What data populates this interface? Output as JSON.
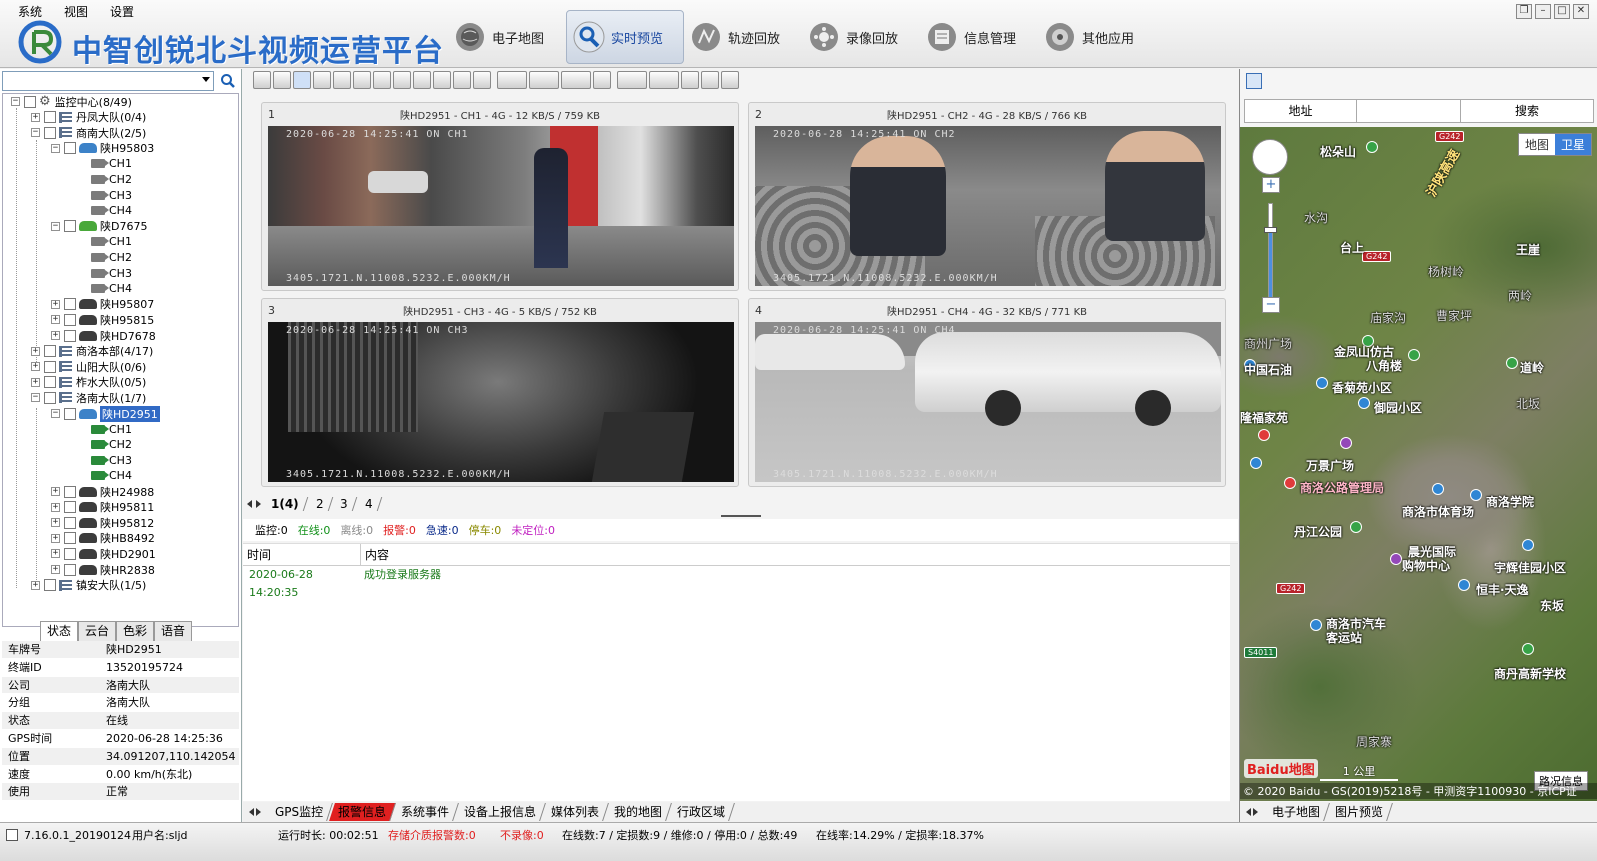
{
  "menu": [
    "系统",
    "视图",
    "设置"
  ],
  "app_title": "中智创锐北斗视频运营平台",
  "nav": [
    {
      "label": "电子地图",
      "icon": "globe-icon",
      "active": false
    },
    {
      "label": "实时预览",
      "icon": "search-icon",
      "active": true
    },
    {
      "label": "轨迹回放",
      "icon": "route-icon",
      "active": false
    },
    {
      "label": "录像回放",
      "icon": "film-reel-icon",
      "active": false
    },
    {
      "label": "信息管理",
      "icon": "folder-icon",
      "active": false
    },
    {
      "label": "其他应用",
      "icon": "disc-icon",
      "active": false
    }
  ],
  "search": {
    "value": "",
    "placeholder": ""
  },
  "tree": {
    "root": "监控中心(8/49)",
    "groups": {
      "g1": "丹凤大队(0/4)",
      "g2": "商南大队(2/5)",
      "g3": "商洛本部(4/17)",
      "g4": "山阳大队(0/6)",
      "g5": "柞水大队(0/5)",
      "g6": "洛南大队(1/7)",
      "g7": "镇安大队(1/5)"
    },
    "vehicles": {
      "v1": "陕H95803",
      "v2": "陕D7675",
      "v3": "陕H95807",
      "v4": "陕H95815",
      "v5": "陕HD7678",
      "v6": "陕HD2951",
      "v7": "陕H24988",
      "v8": "陕H95811",
      "v9": "陕H95812",
      "v10": "陕HB8492",
      "v11": "陕HD2901",
      "v12": "陕HR2838"
    },
    "channels": [
      "CH1",
      "CH2",
      "CH3",
      "CH4"
    ]
  },
  "left_tabs": [
    "状态",
    "云台",
    "色彩",
    "语音"
  ],
  "props": [
    {
      "k": "车牌号",
      "v": "陕HD2951"
    },
    {
      "k": "终端ID",
      "v": "13520195724"
    },
    {
      "k": "公司",
      "v": "洛南大队"
    },
    {
      "k": "分组",
      "v": "洛南大队"
    },
    {
      "k": "状态",
      "v": "在线"
    },
    {
      "k": "GPS时间",
      "v": "2020-06-28 14:25:36"
    },
    {
      "k": "位置",
      "v": "34.091207,110.142054"
    },
    {
      "k": "速度",
      "v": "0.00 km/h(东北)"
    },
    {
      "k": "使用",
      "v": "正常"
    }
  ],
  "videos": [
    {
      "num": "1",
      "title": "陕HD2951 - CH1 - 4G - 12 KB/S / 759 KB",
      "osd_top": "2020-06-28 14:25:41  ON   CH1",
      "osd_bot": "3405.1721.N.11008.5232.E.000KM/H"
    },
    {
      "num": "2",
      "title": "陕HD2951 - CH2 - 4G - 28 KB/S / 766 KB",
      "osd_top": "2020-06-28 14:25:41  ON   CH2",
      "osd_bot": "3405.1721.N.11008.5232.E.000KM/H"
    },
    {
      "num": "3",
      "title": "陕HD2951 - CH3 - 4G - 5 KB/S / 752 KB",
      "osd_top": "2020-06-28 14:25:41  ON   CH3",
      "osd_bot": "3405.1721.N.11008.5232.E.000KM/H"
    },
    {
      "num": "4",
      "title": "陕HD2951 - CH4 - 4G - 32 KB/S / 771 KB",
      "osd_top": "2020-06-28 14:25:41  ON   CH4",
      "osd_bot": "3405.1721.N.11008.5232.E.000KM/H"
    }
  ],
  "pages": [
    "1(4)",
    "2",
    "3",
    "4"
  ],
  "counts": [
    {
      "label": "监控:0",
      "color": "#000000"
    },
    {
      "label": "在线:0",
      "color": "#12911a"
    },
    {
      "label": "离线:0",
      "color": "#8a8a8a"
    },
    {
      "label": "报警:0",
      "color": "#e02020"
    },
    {
      "label": "急速:0",
      "color": "#0a2a8a"
    },
    {
      "label": "停车:0",
      "color": "#8a8a00"
    },
    {
      "label": "未定位:0",
      "color": "#c020c0"
    }
  ],
  "log": {
    "headers": [
      "时间",
      "内容"
    ],
    "rows": [
      {
        "time": "2020-06-28 14:20:35",
        "msg": "成功登录服务器"
      }
    ]
  },
  "bottom_tabs": [
    "GPS监控",
    "报警信息",
    "系统事件",
    "设备上报信息",
    "媒体列表",
    "我的地图",
    "行政区域"
  ],
  "map": {
    "search_tabs": [
      "地址",
      "",
      "搜索"
    ],
    "type_buttons": [
      "地图",
      "卫星"
    ],
    "labels": [
      "松朵山",
      "台上",
      "王崖",
      "杨树岭",
      "庙家沟",
      "曹家坪",
      "金凤山仿古",
      "八角楼",
      "道岭",
      "中国石油",
      "香菊苑小区",
      "御园小区",
      "隆福家苑",
      "万景广场",
      "商洛公路管理局",
      "商洛学院",
      "商洛市体育场",
      "丹江公园",
      "晨光国际",
      "购物中心",
      "宇辉佳园小区",
      "恒丰·天逸",
      "商洛市汽车",
      "客运站",
      "东坂",
      "商丹高新学校",
      "周家寨",
      "水沟",
      "北坂",
      "商州广场",
      "两岭"
    ],
    "shields": [
      "G242",
      "G242",
      "G242",
      "S4011"
    ],
    "road_label": "沪陕高速",
    "zoom_fraction": 0.72,
    "baidu_logo": "Baidu地图",
    "scale_label": "1 公里",
    "traffic_label": "路况信息",
    "copyright": "© 2020 Baidu - GS(2019)5218号 - 甲测资字1100930 - 京ICP证",
    "tabs": [
      "电子地图",
      "图片预览"
    ]
  },
  "statusbar": {
    "version": "7.16.0.1_20190124",
    "user": "用户名:sljd",
    "runtime": "运行时长: 00:02:51",
    "storage_alarm": "存储介质报警数:0",
    "no_record": "不录像:0",
    "stats": "在线数:7 / 定损数:9 / 维修:0 / 停用:0 / 总数:49",
    "rates": "在线率:14.29% / 定损率:18.37%"
  }
}
